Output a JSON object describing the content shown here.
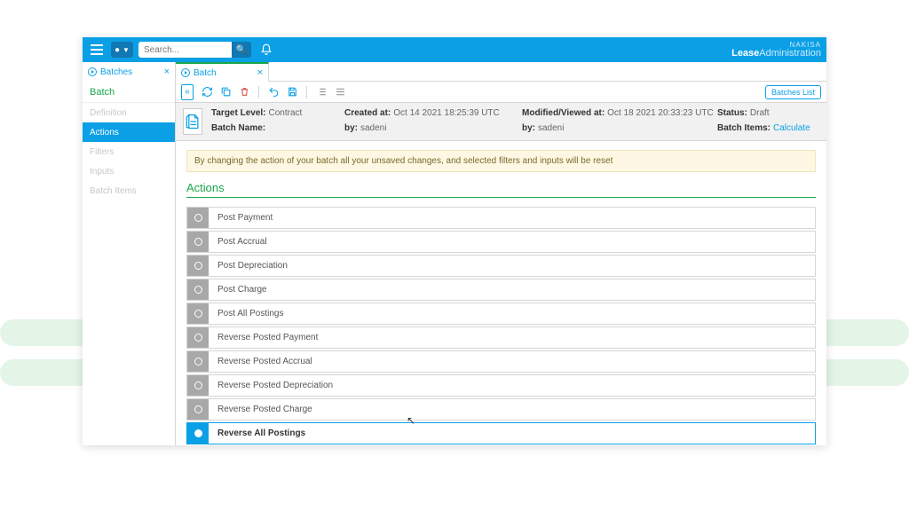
{
  "topbar": {
    "search_placeholder": "Search...",
    "brand_top": "NAKISA",
    "brand_name": "Lease",
    "brand_suffix": "Administration"
  },
  "tabs": [
    {
      "label": "Batches"
    },
    {
      "label": "Batch"
    }
  ],
  "sidebar": {
    "heading": "Batch",
    "items": [
      {
        "label": "Definition"
      },
      {
        "label": "Actions"
      },
      {
        "label": "Filters"
      },
      {
        "label": "Inputs"
      },
      {
        "label": "Batch Items"
      }
    ]
  },
  "toolbar": {
    "batches_list": "Batches List"
  },
  "info": {
    "target_level_label": "Target Level:",
    "target_level_value": "Contract",
    "created_at_label": "Created at:",
    "created_at_value": "Oct 14 2021 18:25:39 UTC",
    "modified_at_label": "Modified/Viewed at:",
    "modified_at_value": "Oct 18 2021 20:33:23 UTC",
    "status_label": "Status:",
    "status_value": "Draft",
    "batch_name_label": "Batch Name:",
    "batch_name_value": "",
    "by_label": "by:",
    "by1_value": "sadeni",
    "by2_value": "sadeni",
    "batch_items_label": "Batch Items:",
    "batch_items_value": "Calculate"
  },
  "warning_text": "By changing the action of your batch all your unsaved changes, and selected filters and inputs will be reset",
  "section_title": "Actions",
  "actions": [
    "Post Payment",
    "Post Accrual",
    "Post Depreciation",
    "Post Charge",
    "Post All Postings",
    "Reverse Posted Payment",
    "Reverse Posted Accrual",
    "Reverse Posted Depreciation",
    "Reverse Posted Charge",
    "Reverse All Postings"
  ]
}
